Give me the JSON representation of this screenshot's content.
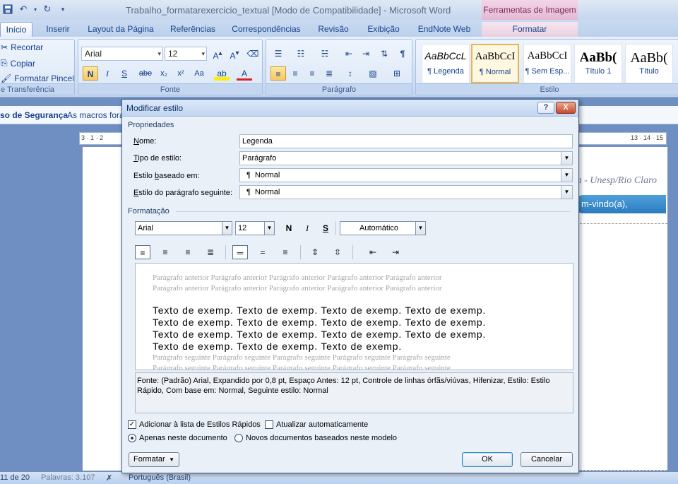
{
  "window": {
    "title": "Trabalho_formatarexercicio_textual [Modo de Compatibilidade] - Microsoft Word",
    "context_tab_group": "Ferramentas de Imagem"
  },
  "tabs": [
    "Início",
    "Inserir",
    "Layout da Página",
    "Referências",
    "Correspondências",
    "Revisão",
    "Exibição",
    "EndNote Web",
    "Formatar"
  ],
  "ribbon": {
    "clipboard": {
      "cut": "Recortar",
      "copy": "Copiar",
      "format_painter": "Formatar Pincel",
      "label": "e Transferência"
    },
    "font": {
      "name": "Arial",
      "size": "12",
      "label": "Fonte",
      "bold": "N",
      "italic": "I",
      "underline": "S",
      "strike": "abe",
      "subscript": "x₂",
      "superscript": "x²",
      "case": "Aa"
    },
    "paragraph": {
      "label": "Parágrafo"
    },
    "styles": {
      "label": "Estilo",
      "items": [
        {
          "sample": "AaBbCcL",
          "name": "¶ Legenda"
        },
        {
          "sample": "AaBbCcI",
          "name": "¶ Normal"
        },
        {
          "sample": "AaBbCcI",
          "name": "¶ Sem Esp..."
        },
        {
          "sample": "AaBb(",
          "name": "Título 1"
        },
        {
          "sample": "AaBb(",
          "name": "Título"
        }
      ]
    }
  },
  "security_bar": {
    "label": "so de Segurança",
    "message": "As macros fora"
  },
  "document": {
    "ruler_left": "3 · 1 · 2",
    "ruler_right": "13 · 14 · 15",
    "header_text": "a - Unesp/Rio Claro",
    "welcome": "m-vindo(a), Amanda."
  },
  "status": {
    "page": "11 de 20",
    "words": "Palavras: 3.107",
    "language": "Português (Brasil)"
  },
  "dialog": {
    "title": "Modificar estilo",
    "help": "?",
    "close": "X",
    "properties_title": "Propriedades",
    "name_label": "Nome:",
    "name_value": "Legenda",
    "style_type_label": "Tipo de estilo:",
    "style_type_value": "Parágrafo",
    "based_on_label": "Estilo baseado em:",
    "based_on_value": "Normal",
    "next_style_label": "Estilo do parágrafo seguinte:",
    "next_style_value": "Normal",
    "formatting_title": "Formatação",
    "font": "Arial",
    "size": "12",
    "bold": "N",
    "italic": "I",
    "underline": "S",
    "color": "Automático",
    "preview": {
      "previous": "Parágrafo anterior Parágrafo anterior Parágrafo anterior Parágrafo anterior Parágrafo anterior",
      "sample": "Texto de exemp. Texto de exemp. Texto de exemp. Texto de exemp.",
      "sample_last": "Texto de exemp. Texto de exemp. Texto de exemp.",
      "next": "Parágrafo seguinte Parágrafo seguinte Parágrafo seguinte Parágrafo seguinte Parágrafo seguinte"
    },
    "description": "Fonte: (Padrão) Arial, Expandido por  0,8 pt, Espaço Antes:  12 pt, Controle de linhas órfãs/viúvas, Hifenizar, Estilo: Estilo Rápido, Com base em: Normal, Seguinte estilo: Normal",
    "add_quick_styles": "Adicionar à lista de Estilos Rápidos",
    "auto_update": "Atualizar automaticamente",
    "only_this_doc": "Apenas neste documento",
    "new_docs": "Novos documentos baseados neste modelo",
    "format_button": "Formatar",
    "ok": "OK",
    "cancel": "Cancelar"
  }
}
